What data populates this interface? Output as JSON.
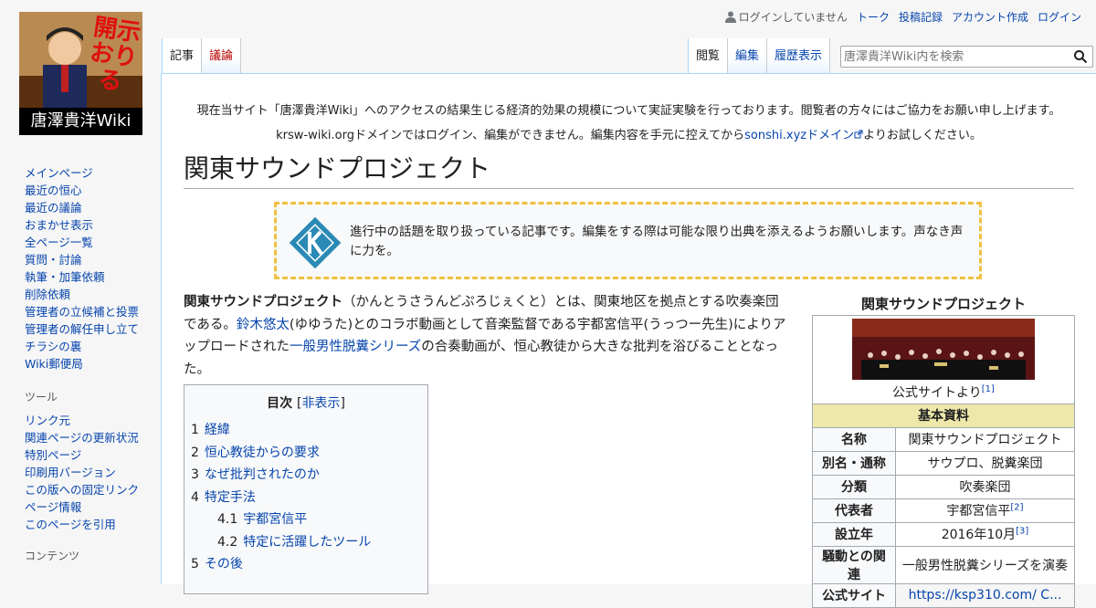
{
  "logo": {
    "caption": "唐澤貴洋Wiki",
    "stamp_text": "開示おりる"
  },
  "personal": {
    "not_logged_in": "ログインしていません",
    "talk": "トーク",
    "contributions": "投稿記録",
    "create_account": "アカウント作成",
    "login": "ログイン"
  },
  "tabs": {
    "article": "記事",
    "discussion": "議論",
    "read": "閲覧",
    "edit": "編集",
    "history": "履歴表示"
  },
  "search": {
    "placeholder": "唐澤貴洋Wiki内を検索"
  },
  "sidebar": {
    "nav": [
      "メインページ",
      "最近の恒心",
      "最近の議論",
      "おまかせ表示",
      "全ページ一覧",
      "質問・討論",
      "執筆・加筆依頼",
      "削除依頼",
      "管理者の立候補と投票",
      "管理者の解任申し立て",
      "チラシの裏",
      "Wiki郵便局"
    ],
    "tools_heading": "ツール",
    "tools": [
      "リンク元",
      "関連ページの更新状況",
      "特別ページ",
      "印刷用バージョン",
      "この版への固定リンク",
      "ページ情報",
      "このページを引用"
    ],
    "contents_heading": "コンテンツ"
  },
  "sitenotice": {
    "line1": "現在当サイト「唐澤貴洋Wiki」へのアクセスの結果生じる経済的効果の規模について実証実験を行っております。閲覧者の方々にはご協力をお願い申し上げます。",
    "line2_pre": "krsw-wiki.orgドメインではログイン、編集ができません。編集内容を手元に控えてから",
    "line2_link": "sonshi.xyzドメイン",
    "line2_post": "よりお試しください。"
  },
  "title": "関東サウンドプロジェクト",
  "ambox": {
    "text": "進行中の話題を取り扱っている記事です。編集をする際は可能な限り出典を添えるようお願いします。声なき声に力を。"
  },
  "lead": {
    "bold": "関東サウンドプロジェクト",
    "t1": "（かんとうさうんどぷろじぇくと）とは、関東地区を拠点とする吹奏楽団である。",
    "link1": "鈴木悠太",
    "t2": "(ゆゆうた)とのコラボ動画として音楽監督である宇都宮信平(うっつー先生)によりアップロードされた",
    "link2": "一般男性脱糞シリーズ",
    "t3": "の合奏動画が、恒心教徒から大きな批判を浴びることとなった。"
  },
  "toc": {
    "title": "目次",
    "hide": "非表示",
    "items": [
      {
        "num": "1",
        "label": "経緯"
      },
      {
        "num": "2",
        "label": "恒心教徒からの要求"
      },
      {
        "num": "3",
        "label": "なぜ批判されたのか"
      },
      {
        "num": "4",
        "label": "特定手法"
      },
      {
        "num": "4.1",
        "label": "宇都宮信平"
      },
      {
        "num": "4.2",
        "label": "特定に活躍したツール"
      },
      {
        "num": "5",
        "label": "その後"
      }
    ]
  },
  "infobox": {
    "title": "関東サウンドプロジェクト",
    "caption": "公式サイトより",
    "caption_ref": "[1]",
    "section": "基本資料",
    "rows": [
      {
        "h": "名称",
        "v": "関東サウンドプロジェクト",
        "ref": ""
      },
      {
        "h": "別名・通称",
        "v": "サウプロ、脱糞楽団",
        "ref": ""
      },
      {
        "h": "分類",
        "v": "吹奏楽団",
        "ref": ""
      },
      {
        "h": "代表者",
        "v": "宇都宮信平",
        "ref": "[2]"
      },
      {
        "h": "設立年",
        "v": "2016年10月",
        "ref": "[3]"
      },
      {
        "h": "騒動との関連",
        "v": "一般男性脱糞シリーズを演奏",
        "ref": ""
      },
      {
        "h": "公式サイト",
        "v": "https://ksp310.com/ C...",
        "ref": ""
      }
    ]
  }
}
